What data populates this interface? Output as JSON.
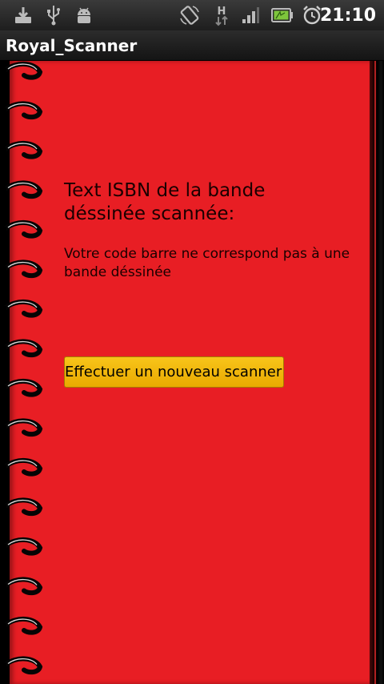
{
  "status_bar": {
    "time": "21:10",
    "icons": [
      "download-icon",
      "usb-icon",
      "android-debug-icon",
      "rotate-icon",
      "hspa-data-icon",
      "signal-icon",
      "battery-icon",
      "alarm-icon"
    ]
  },
  "app": {
    "title": "Royal_Scanner"
  },
  "main": {
    "heading": "Text ISBN de la bande déssinée scannée:",
    "message": "Votre code barre ne correspond pas à une bande déssinée",
    "rescan_button_label": "Effectuer un nouveau scanner"
  },
  "colors": {
    "page_background": "#e81e24",
    "button_background": "#f2b70d",
    "text": "#1a0000"
  }
}
